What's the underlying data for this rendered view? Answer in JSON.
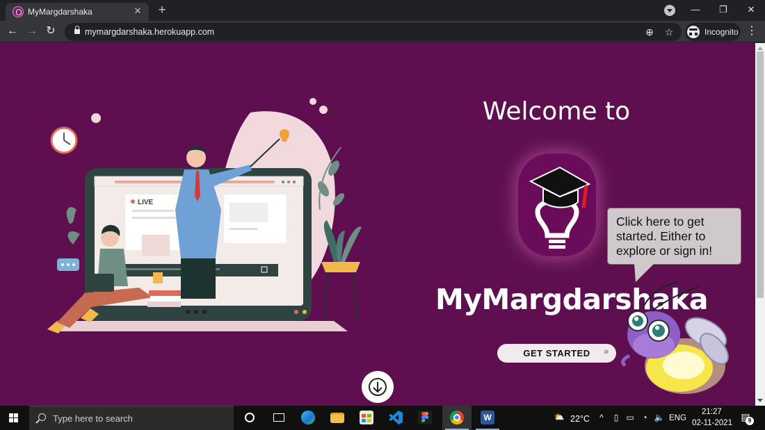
{
  "browser": {
    "tab_title": "MyMargdarshaka",
    "tab_close": "✕",
    "new_tab": "+",
    "url": "mymargdarshaka.herokuapp.com",
    "incognito_label": "Incognito",
    "window_minimize": "—",
    "window_restore": "❐",
    "window_close": "✕"
  },
  "page": {
    "welcome": "Welcome to",
    "brand": "MyMargdarshaka",
    "cta_label": "GET STARTED",
    "cta_chevron": "»",
    "speech_bubble": "Click here to get started. Either to explore or sign in!",
    "illustration_live_label": "LIVE",
    "colors": {
      "background": "#5f0f4f",
      "logo_badge": "#6a0c59",
      "accent_red": "#e11d1d"
    }
  },
  "taskbar": {
    "search_placeholder": "Type here to search",
    "weather_temp": "22°C",
    "language": "ENG",
    "time": "21:27",
    "date": "02-11-2021",
    "notification_count": "9"
  }
}
